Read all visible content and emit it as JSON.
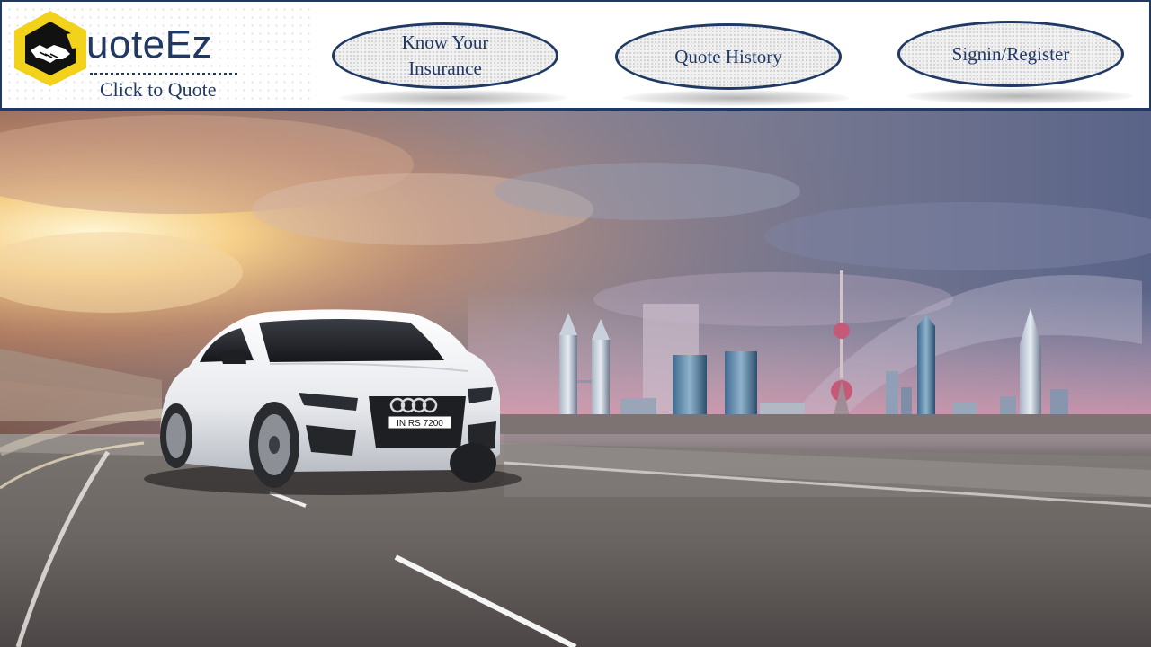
{
  "brand": {
    "name": "uoteEz",
    "tagline": "Click to Quote",
    "logo_icon": "handshake-icon",
    "colors": {
      "navy": "#1f3864",
      "hex_yellow": "#f2d21a",
      "hex_black": "#111111"
    }
  },
  "nav": {
    "items": [
      {
        "label": "Know Your Insurance"
      },
      {
        "label": "Quote History"
      },
      {
        "label": "Signin/Register"
      }
    ]
  },
  "hero": {
    "image": "car-city-skyline-banner",
    "plate_text": "IN RS 7200"
  }
}
